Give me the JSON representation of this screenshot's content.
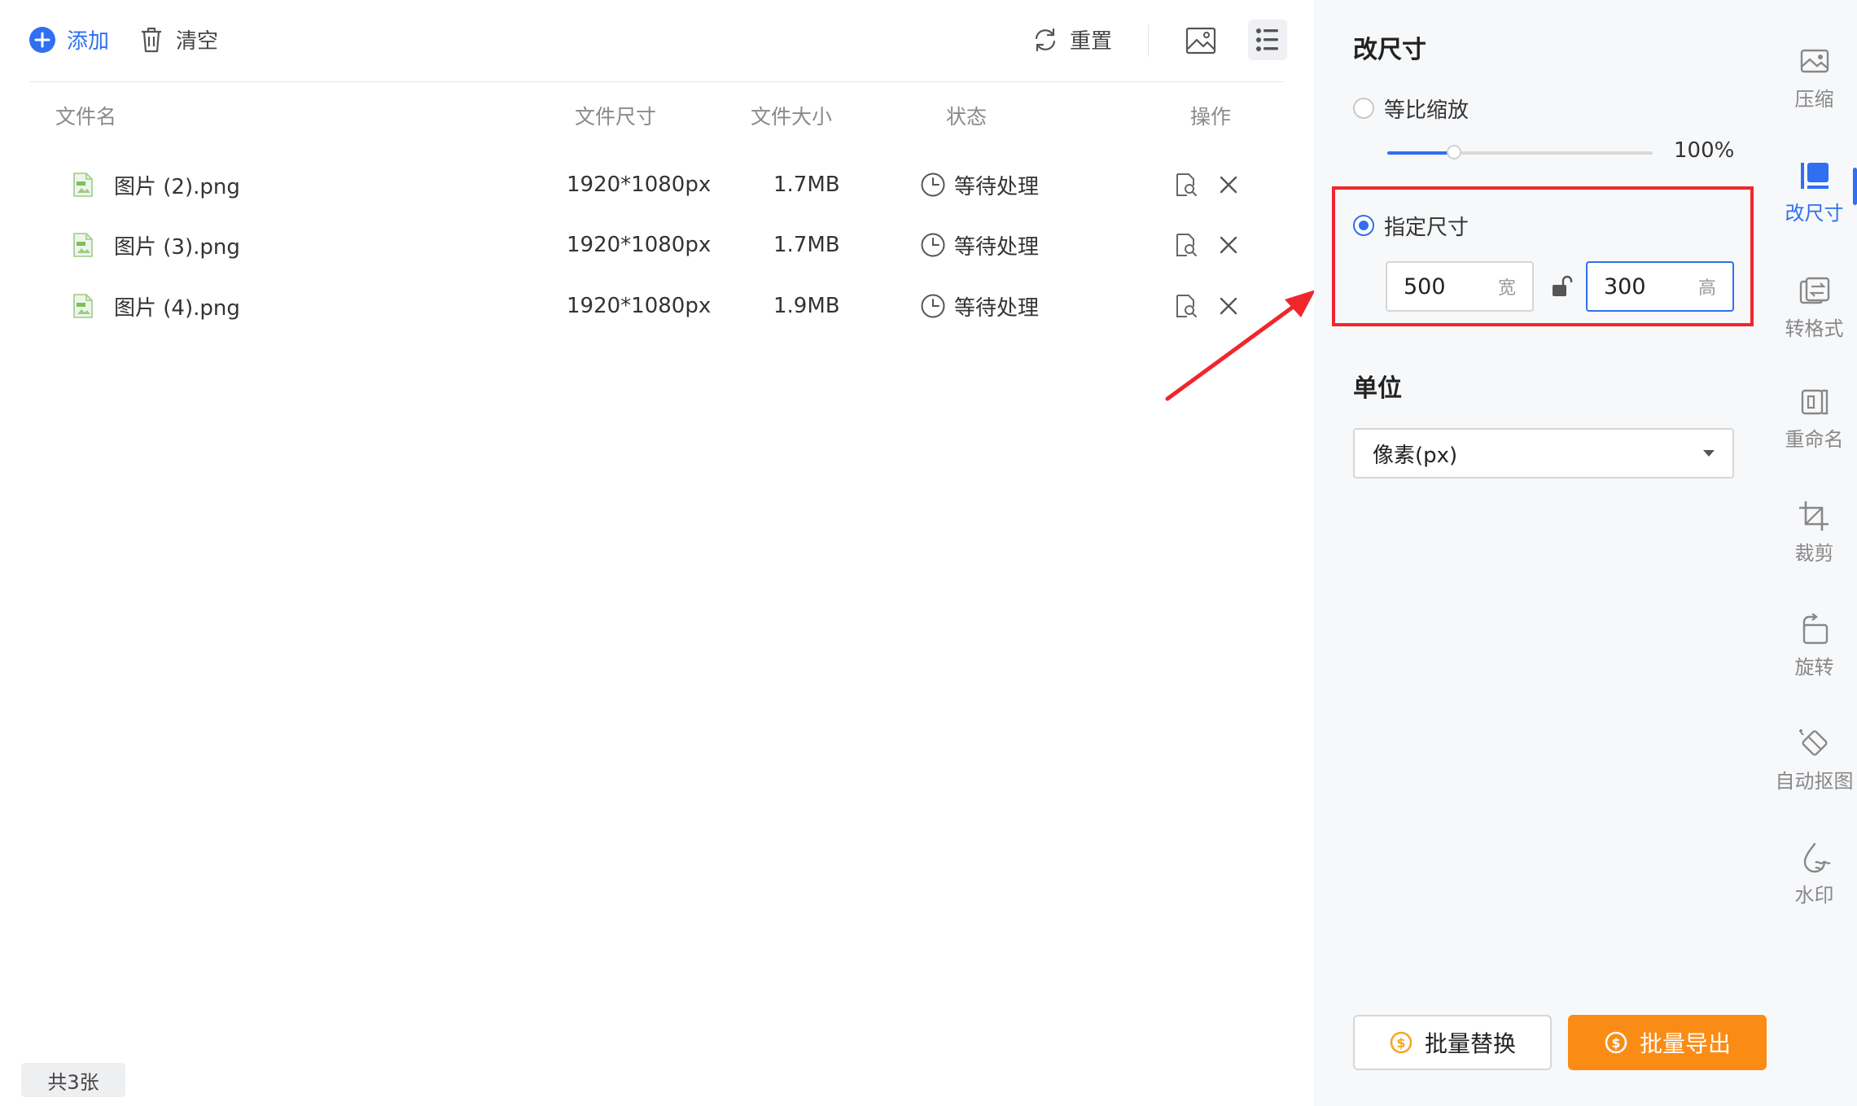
{
  "toolbar": {
    "add_label": "添加",
    "clear_label": "清空",
    "reset_label": "重置"
  },
  "table": {
    "headers": [
      "文件名",
      "文件尺寸",
      "文件大小",
      "状态",
      "操作"
    ],
    "rows": [
      {
        "name": "图片 (2).png",
        "dimensions": "1920*1080px",
        "size": "1.7MB",
        "status": "等待处理"
      },
      {
        "name": "图片 (3).png",
        "dimensions": "1920*1080px",
        "size": "1.7MB",
        "status": "等待处理"
      },
      {
        "name": "图片 (4).png",
        "dimensions": "1920*1080px",
        "size": "1.9MB",
        "status": "等待处理"
      }
    ]
  },
  "footer": {
    "count": "共3张"
  },
  "panel": {
    "title": "改尺寸",
    "proportional_label": "等比缩放",
    "scale_value": 0.25,
    "scale_text": "100%",
    "specified_label": "指定尺寸",
    "width_value": "500",
    "width_unit": "宽",
    "height_value": "300",
    "height_unit": "高",
    "unit_title": "单位",
    "unit_selected": "像素(px)",
    "replace_button": "批量替换",
    "export_button": "批量导出"
  },
  "sidebar": {
    "items": [
      {
        "label": "压缩",
        "icon": "compress-icon"
      },
      {
        "label": "改尺寸",
        "icon": "resize-icon",
        "active": true
      },
      {
        "label": "转格式",
        "icon": "convert-icon"
      },
      {
        "label": "重命名",
        "icon": "rename-icon"
      },
      {
        "label": "裁剪",
        "icon": "crop-icon"
      },
      {
        "label": "旋转",
        "icon": "rotate-icon"
      },
      {
        "label": "自动抠图",
        "icon": "cutout-icon"
      },
      {
        "label": "水印",
        "icon": "watermark-icon"
      }
    ]
  },
  "colors": {
    "accent": "#2f6ff0",
    "export_orange": "#fa8c16",
    "highlight_red": "#f0262c"
  }
}
